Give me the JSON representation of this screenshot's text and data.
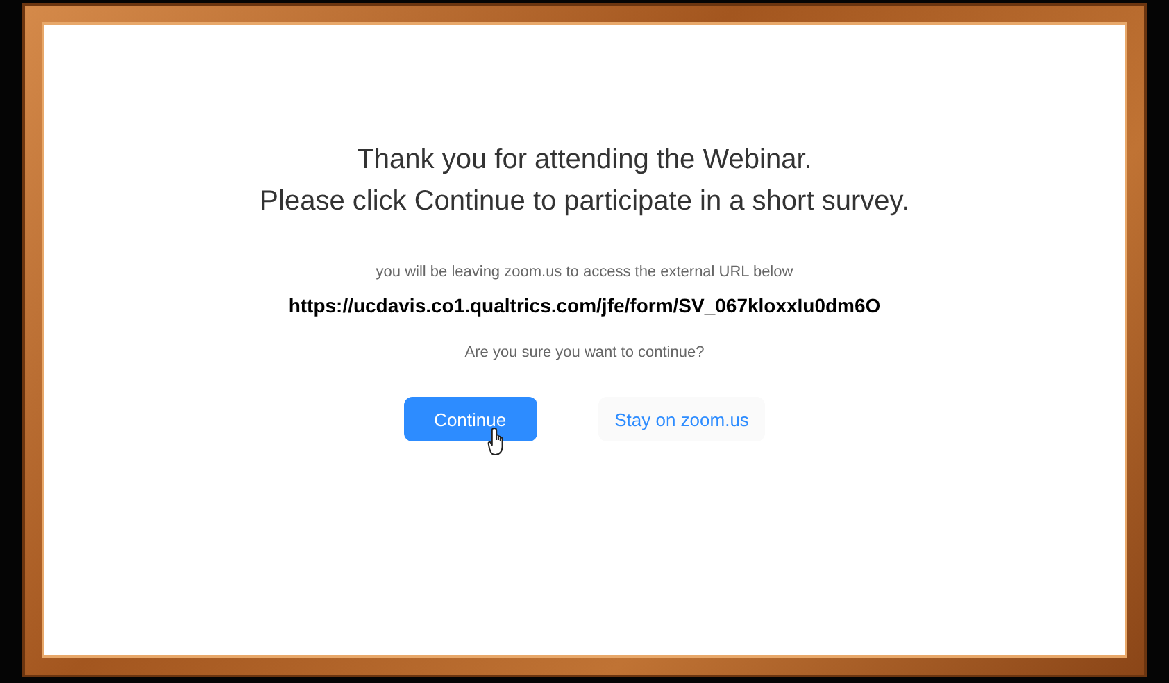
{
  "heading": [
    "Thank you for attending the Webinar.",
    "Please click Continue to participate in a short survey."
  ],
  "notice": "you will be leaving zoom.us to access the external URL below",
  "url": "https://ucdavis.co1.qualtrics.com/jfe/form/SV_067kloxxIu0dm6O",
  "question": "Are you sure you want to continue?",
  "buttons": [
    {
      "label": "Continue",
      "kind": "primary"
    },
    {
      "label": "Stay on zoom.us",
      "kind": "secondary"
    }
  ]
}
